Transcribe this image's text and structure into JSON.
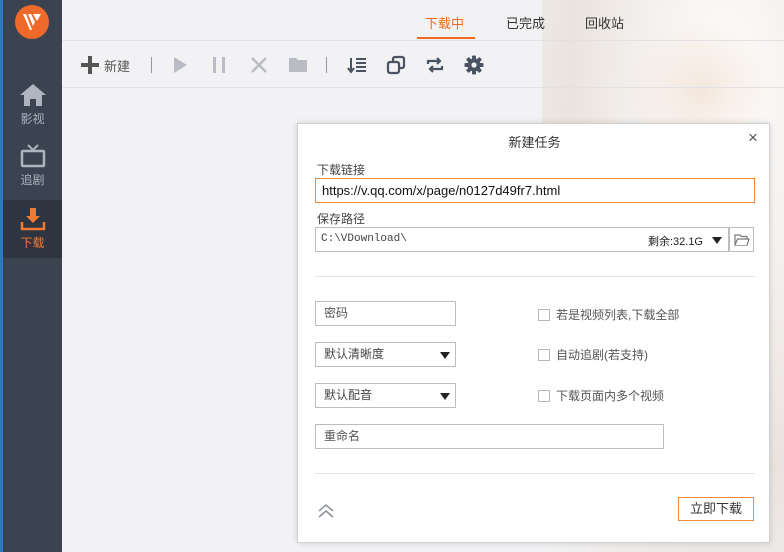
{
  "sidebar": {
    "items": [
      {
        "label": "影视",
        "icon": "home-icon"
      },
      {
        "label": "追剧",
        "icon": "tv-icon"
      },
      {
        "label": "下载",
        "icon": "download-icon"
      }
    ],
    "accent": "#f06b1e"
  },
  "tabs": [
    {
      "label": "下载中"
    },
    {
      "label": "已完成"
    },
    {
      "label": "回收站"
    }
  ],
  "toolbar": {
    "new_label": "新建",
    "icons": [
      "plus-icon",
      "play-icon",
      "pause-icon",
      "delete-icon",
      "folder-icon",
      "sort-icon",
      "copy-icon",
      "refresh-icon",
      "settings-icon"
    ]
  },
  "dialog": {
    "title": "新建任务",
    "close_glyph": "×",
    "link_label": "下载链接",
    "link_value": "https://v.qq.com/x/page/n0127d49fr7.html",
    "path_label": "保存路径",
    "path_value": "C:\\VDownload\\",
    "free_space": "剩余:32.1G",
    "password_placeholder": "密码",
    "quality_value": "默认清晰度",
    "audio_value": "默认配音",
    "rename_placeholder": "重命名",
    "checkboxes": [
      {
        "label": "若是视频列表,下载全部",
        "checked": false
      },
      {
        "label": "自动追剧(若支持)",
        "checked": false
      },
      {
        "label": "下载页面内多个视频",
        "checked": false
      }
    ],
    "start_label": "立即下载"
  }
}
